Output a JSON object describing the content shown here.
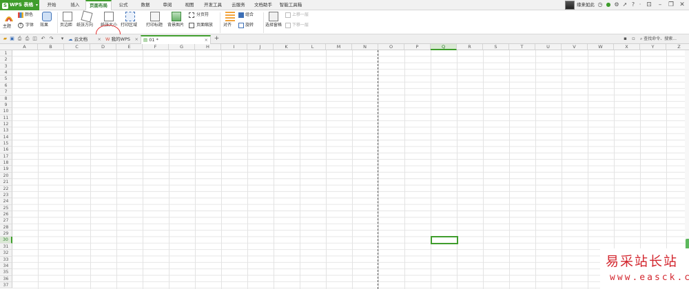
{
  "app": {
    "name": "WPS 表格",
    "logo_letter": "S"
  },
  "menu_tabs": [
    "开始",
    "插入",
    "页面布局",
    "公式",
    "数据",
    "审阅",
    "视图",
    "开发工具",
    "云服务",
    "文档助手",
    "智能工具箱"
  ],
  "active_menu_tab": "页面布局",
  "user": {
    "name": "缘来如此"
  },
  "ribbon": {
    "theme_label": "主题",
    "colors_label": "颜色",
    "fonts_label": "字体",
    "effects_label": "效果",
    "margins_label": "页边距",
    "orientation_label": "纸张方向",
    "size_label": "纸张大小",
    "print_area_label": "打印区域",
    "print_titles_label": "打印标题",
    "background_label": "背景图片",
    "page_break_label": "分页符",
    "page_zoom_label": "页面缩放",
    "align_label": "对齐",
    "group_label": "组合",
    "rotate_label": "旋转",
    "selection_pane_label": "选择窗格",
    "bring_forward_label": "上移一层",
    "send_backward_label": "下移一层"
  },
  "doc_tabs": [
    {
      "label": "云文档"
    },
    {
      "label": "我的WPS"
    },
    {
      "label": "01 *"
    }
  ],
  "search_placeholder": "查找命令、搜索...",
  "columns": [
    "A",
    "B",
    "C",
    "D",
    "E",
    "F",
    "G",
    "H",
    "I",
    "J",
    "K",
    "L",
    "M",
    "N",
    "O",
    "P",
    "Q",
    "R",
    "S",
    "T",
    "U",
    "V",
    "W",
    "X",
    "Y",
    "Z"
  ],
  "rows_visible": 37,
  "selected_cell": {
    "column": "Q",
    "row": 30
  },
  "page_break_after_column": "N",
  "watermark": {
    "text": "易采站长站",
    "url": "www.easck.com"
  },
  "colors": {
    "accent": "#3f9d2c",
    "annotation_circle": "#e23030",
    "watermark": "#d3272f"
  }
}
